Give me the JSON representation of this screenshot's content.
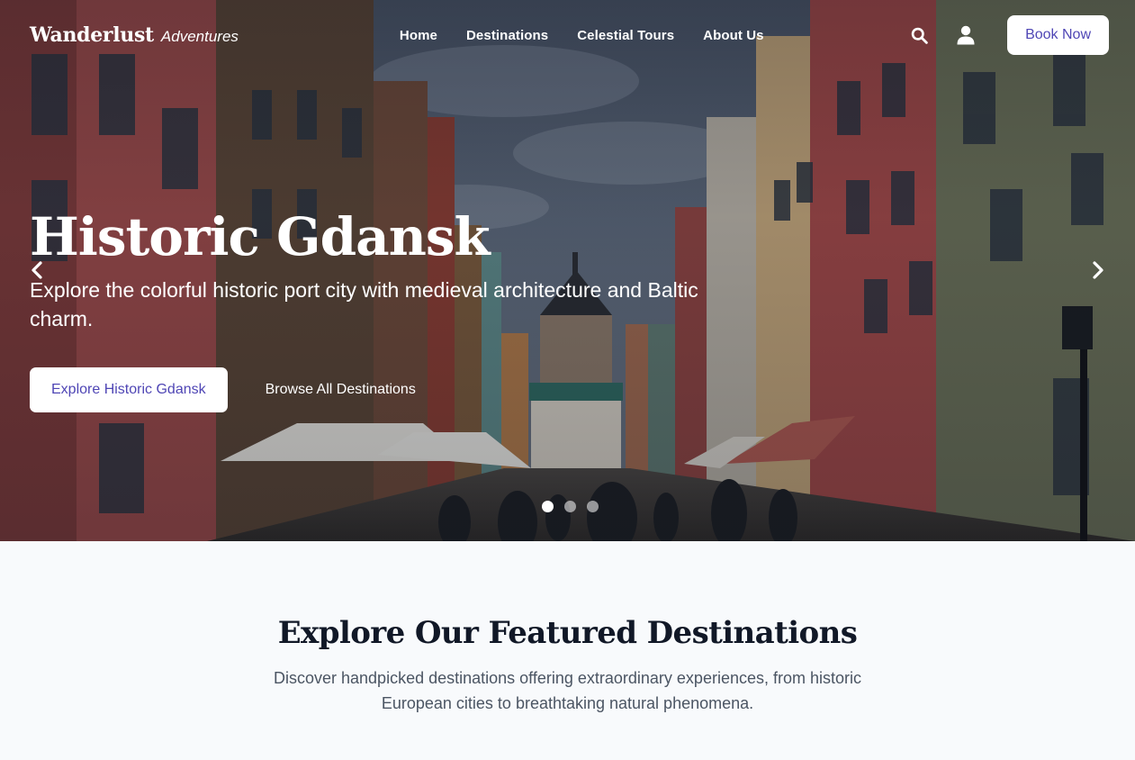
{
  "nav": {
    "logo_main": "Wanderlust",
    "logo_sub": "Adventures",
    "links": [
      "Home",
      "Destinations",
      "Celestial Tours",
      "About Us"
    ],
    "search_icon": "search-icon",
    "user_icon": "user-icon",
    "book_label": "Book Now"
  },
  "hero": {
    "title": "Historic Gdansk",
    "subtitle": "Explore the colorful historic port city with medieval architecture and Baltic charm.",
    "primary_cta": "Explore Historic Gdansk",
    "secondary_cta": "Browse All Destinations",
    "prev_icon": "chevron-left-icon",
    "next_icon": "chevron-right-icon",
    "slides_total": 3,
    "active_slide": 1
  },
  "featured": {
    "title": "Explore Our Featured Destinations",
    "description": "Discover handpicked destinations offering extraordinary experiences, from historic European cities to breathtaking natural phenomena."
  },
  "colors": {
    "accent": "#4f46b5",
    "background": "#f8fafc",
    "heading": "#111827"
  }
}
